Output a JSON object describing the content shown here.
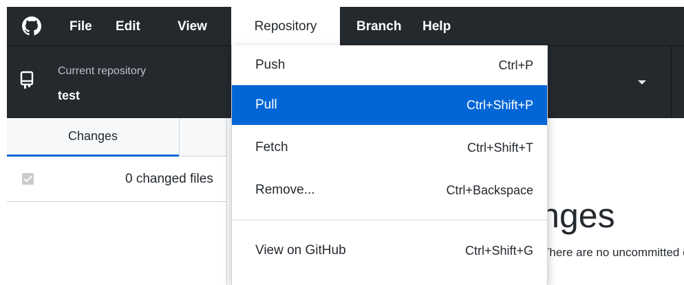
{
  "menubar": {
    "items": [
      {
        "label": "File"
      },
      {
        "label": "Edit"
      },
      {
        "label": "View"
      },
      {
        "label": "Repository"
      },
      {
        "label": "Branch"
      },
      {
        "label": "Help"
      }
    ],
    "open_menu": "Repository"
  },
  "toolbar": {
    "current_repository_label": "Current repository",
    "repository_name": "test"
  },
  "sidebar": {
    "tab_changes": "Changes",
    "changed_files": "0 changed files"
  },
  "main": {
    "title": "No local changes",
    "subtitle": "There are no uncommitted changes"
  },
  "repository_menu": {
    "items": [
      {
        "label": "Push",
        "shortcut": "Ctrl+P"
      },
      {
        "label": "Pull",
        "shortcut": "Ctrl+Shift+P",
        "selected": true
      },
      {
        "label": "Fetch",
        "shortcut": "Ctrl+Shift+T"
      },
      {
        "label": "Remove...",
        "shortcut": "Ctrl+Backspace"
      },
      {
        "label": "View on GitHub",
        "shortcut": "Ctrl+Shift+G"
      }
    ]
  },
  "icons": {
    "app_logo": "github-mark-icon",
    "repository": "repo-icon",
    "dropdown": "caret-down-icon",
    "checkbox": "checkmark-icon"
  },
  "colors": {
    "menubar_bg": "#24292e",
    "selection_blue": "#0366d6",
    "tab_underline": "#0366d6"
  }
}
